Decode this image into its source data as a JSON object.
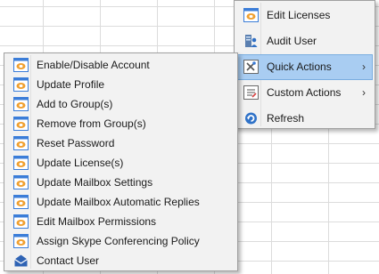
{
  "context_menu": {
    "items": [
      {
        "label": "Edit Licenses",
        "icon": "license-icon"
      },
      {
        "label": "Audit User",
        "icon": "audit-user-icon"
      },
      {
        "label": "Quick Actions",
        "icon": "quick-actions-icon",
        "submenu": true,
        "highlighted": true
      },
      {
        "label": "Custom Actions",
        "icon": "custom-actions-icon",
        "submenu": true
      },
      {
        "label": "Refresh",
        "icon": "refresh-icon"
      }
    ],
    "chevron": "›"
  },
  "quick_actions_submenu": {
    "items": [
      {
        "label": "Enable/Disable Account"
      },
      {
        "label": "Update Profile"
      },
      {
        "label": "Add to Group(s)"
      },
      {
        "label": "Remove from Group(s)"
      },
      {
        "label": "Reset Password"
      },
      {
        "label": "Update License(s)"
      },
      {
        "label": "Update Mailbox Settings"
      },
      {
        "label": "Update Mailbox Automatic Replies"
      },
      {
        "label": "Edit Mailbox Permissions"
      },
      {
        "label": "Assign Skype Conferencing Policy"
      },
      {
        "label": "Contact User"
      }
    ]
  },
  "colors": {
    "highlight": "#a9cdf2",
    "menu_bg": "#f2f2f2",
    "icon_blue": "#3b7dd8",
    "icon_orange": "#f0a030"
  }
}
